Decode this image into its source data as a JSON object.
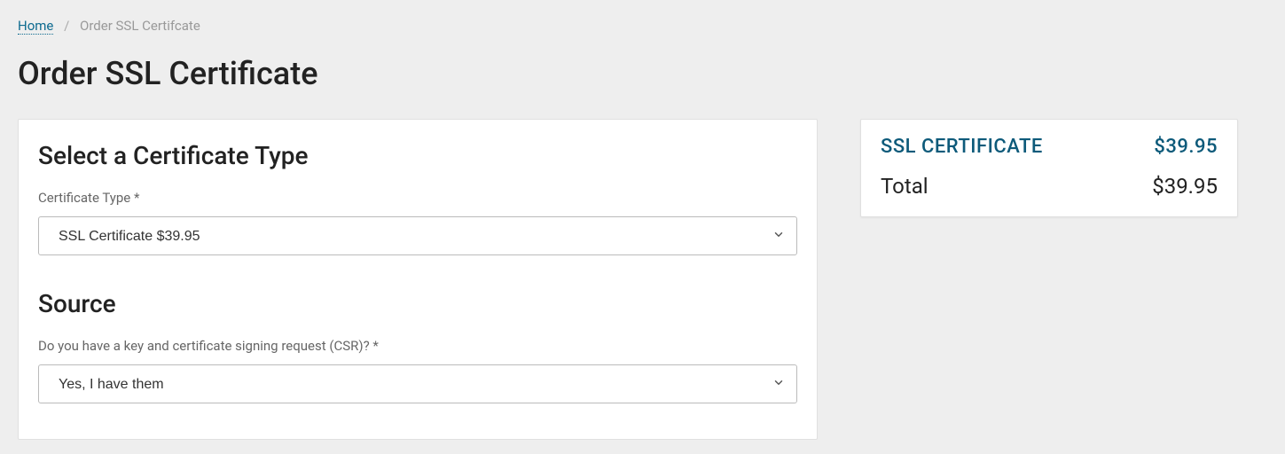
{
  "breadcrumb": {
    "home": "Home",
    "current": "Order SSL Certifcate"
  },
  "page_title": "Order SSL Certificate",
  "form": {
    "cert_type": {
      "heading": "Select a Certificate Type",
      "label": "Certificate Type *",
      "selected": "SSL Certificate $39.95"
    },
    "source": {
      "heading": "Source",
      "label": "Do you have a key and certificate signing request (CSR)? *",
      "selected": "Yes, I have them"
    }
  },
  "summary": {
    "item_label": "SSL CERTIFICATE",
    "item_price": "$39.95",
    "total_label": "Total",
    "total_price": "$39.95"
  }
}
